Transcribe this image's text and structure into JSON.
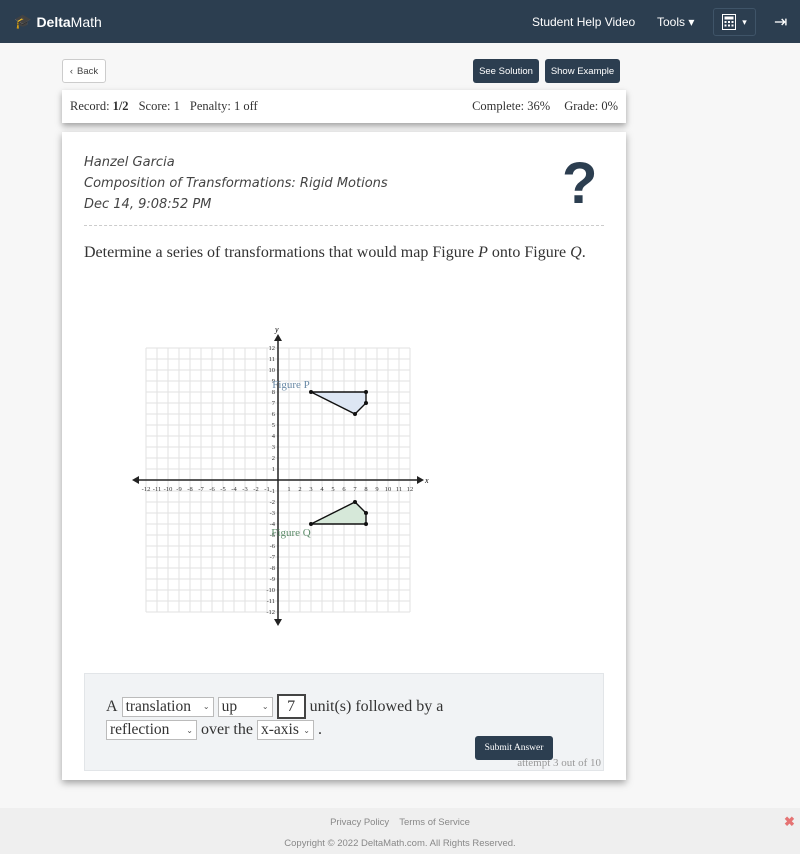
{
  "nav": {
    "brand_bold": "Delta",
    "brand_rest": "Math",
    "help": "Student Help Video",
    "tools": "Tools ▾",
    "calc_caret": "▾",
    "icons": [
      "graduation-cap-icon",
      "calculator-icon",
      "logout-icon"
    ]
  },
  "toolbar": {
    "back": "Back",
    "see_solution": "See Solution",
    "show_example": "Show Example"
  },
  "record": {
    "record_label": "Record:",
    "record_value": "1/2",
    "score": "Score: 1",
    "penalty": "Penalty: 1 off",
    "complete": "Complete: 36%",
    "grade": "Grade: 0%"
  },
  "meta": {
    "student": "Hanzel Garcia",
    "assignment": "Composition of Transformations: Rigid Motions",
    "date": "Dec 14, 9:08:52 PM",
    "help_icon": "?"
  },
  "question": {
    "pre": "Determine a series of transformations that would map Figure ",
    "p": "P",
    "mid": " onto Figure ",
    "q": "Q",
    "post": "."
  },
  "graph": {
    "x_label": "x",
    "y_label": "y",
    "range": [
      -12,
      12
    ],
    "figures": [
      {
        "label": "Figure P",
        "vertices": [
          [
            3,
            8
          ],
          [
            8,
            8
          ],
          [
            8,
            7
          ],
          [
            7,
            6
          ]
        ],
        "fill": "#dde6f3",
        "label_color": "#6a8aa6"
      },
      {
        "label": "Figure Q",
        "vertices": [
          [
            3,
            -4
          ],
          [
            8,
            -4
          ],
          [
            8,
            -3
          ],
          [
            7,
            -2
          ]
        ],
        "fill": "#d6e8d9",
        "label_color": "#5d8c6a"
      }
    ]
  },
  "answer": {
    "a": "A",
    "transform1": "translation",
    "direction": "up",
    "units": "7",
    "units_text": "unit(s) followed by a",
    "transform2": "reflection",
    "over_the": "over the",
    "axis": "x-axis",
    "period": ".",
    "submit": "Submit Answer",
    "attempt": "attempt 3 out of 10"
  },
  "footer": {
    "privacy": "Privacy Policy",
    "terms": "Terms of Service",
    "copyright": "Copyright © 2022 DeltaMath.com. All Rights Reserved.",
    "close": "✖"
  }
}
